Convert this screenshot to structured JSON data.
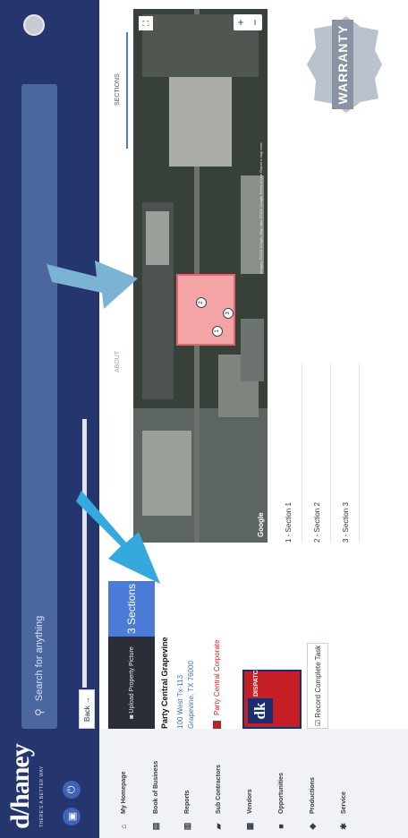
{
  "header": {
    "logo": "d/haney",
    "logo_tagline": "THERE'S A BETTER WAY",
    "search_placeholder": "Search for anything"
  },
  "sidebar": {
    "items": [
      {
        "label": "My Homepage",
        "icon": "home-icon"
      },
      {
        "label": "Book of Business",
        "icon": "book-icon"
      },
      {
        "label": "Reports",
        "icon": "reports-icon"
      },
      {
        "label": "Sub Contractors",
        "icon": "truck-icon"
      },
      {
        "label": "Vendors",
        "icon": "vendors-icon"
      },
      {
        "label": "Opportunities",
        "icon": "folder-icon"
      },
      {
        "label": "Productions",
        "icon": "productions-icon"
      },
      {
        "label": "Service",
        "icon": "wrench-icon"
      }
    ]
  },
  "nav": {
    "back_label": "Back"
  },
  "property": {
    "upload_label": "Upload Property Picture",
    "sections_label": "3 Sections",
    "name": "Party Central Grapevine",
    "address_line1": "100 West Tx-113",
    "address_line2": "Grapevine, TX 76000",
    "corporate": "Party Central Corporate",
    "dispatch_logo_letters": "dk",
    "dispatch_logo_word": "DISPATCH",
    "task_button": "Record Complete Task"
  },
  "tabs": [
    "ABOUT",
    "SECTIONS"
  ],
  "map": {
    "google_label": "Google",
    "pins": [
      "1",
      "2",
      "3"
    ],
    "zoom_in": "+",
    "zoom_out": "−",
    "footer": "Imagery ©2019 Google, Map data ©2019 Google  Terms of Use  Report a map error"
  },
  "section_list": [
    "1 - Section 1",
    "2 - Section 2",
    "3 - Section 3"
  ],
  "badge": {
    "label": "WARRANTY"
  },
  "colors": {
    "header_bg": "#25356d",
    "accent_blue": "#4a7bd6",
    "corporate_red": "#c8282d",
    "arrow_blue": "#35a9dd"
  }
}
